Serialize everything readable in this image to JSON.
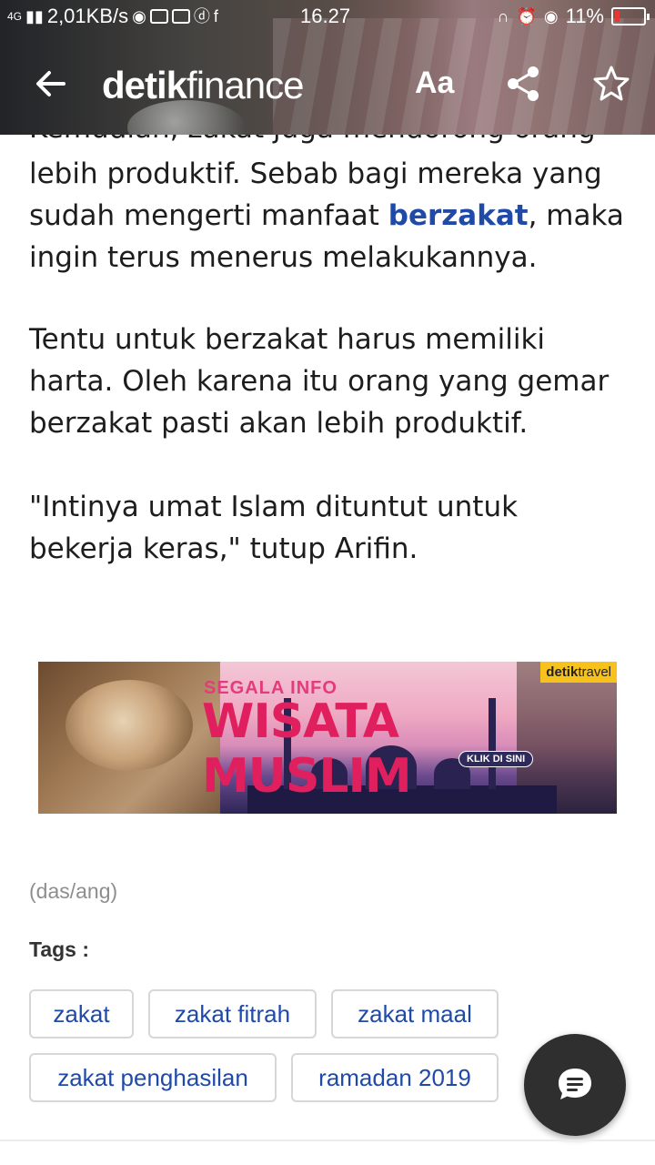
{
  "status_bar": {
    "network": "4G",
    "speed": "2,01KB/s",
    "time": "16.27",
    "battery": "11%"
  },
  "header": {
    "logo_bold": "detik",
    "logo_regular": "finance",
    "font_button": "Aa",
    "icons": [
      "back-arrow-icon",
      "share-icon",
      "star-icon"
    ]
  },
  "article": {
    "paragraph_1_cut": "Kemudian, zakat juga mendorong orang",
    "paragraph_1_a": "lebih produktif. Sebab bagi mereka yang sudah mengerti manfaat ",
    "paragraph_1_link": "berzakat",
    "paragraph_1_b": ", maka ingin terus menerus melakukannya.",
    "paragraph_2": "Tentu untuk berzakat harus memiliki harta. Oleh karena itu orang yang gemar berzakat pasti akan lebih produktif.",
    "paragraph_3": "\"Intinya umat Islam dituntut untuk bekerja keras,\" tutup Arifin."
  },
  "banner": {
    "small_text": "SEGALA INFO",
    "big_text": "WISATA MUSLIM",
    "cta": "KLIK DI SINI",
    "brand_bold": "detik",
    "brand_regular": "travel"
  },
  "source": "(das/ang)",
  "tags_label": "Tags :",
  "tags": [
    "zakat",
    "zakat fitrah",
    "zakat maal",
    "zakat penghasilan",
    "ramadan 2019"
  ],
  "fab": {
    "icon": "chat-icon"
  },
  "colors": {
    "link": "#1f4aa8",
    "fab": "#2f2f2f",
    "tag_border": "#d7d7d7"
  }
}
